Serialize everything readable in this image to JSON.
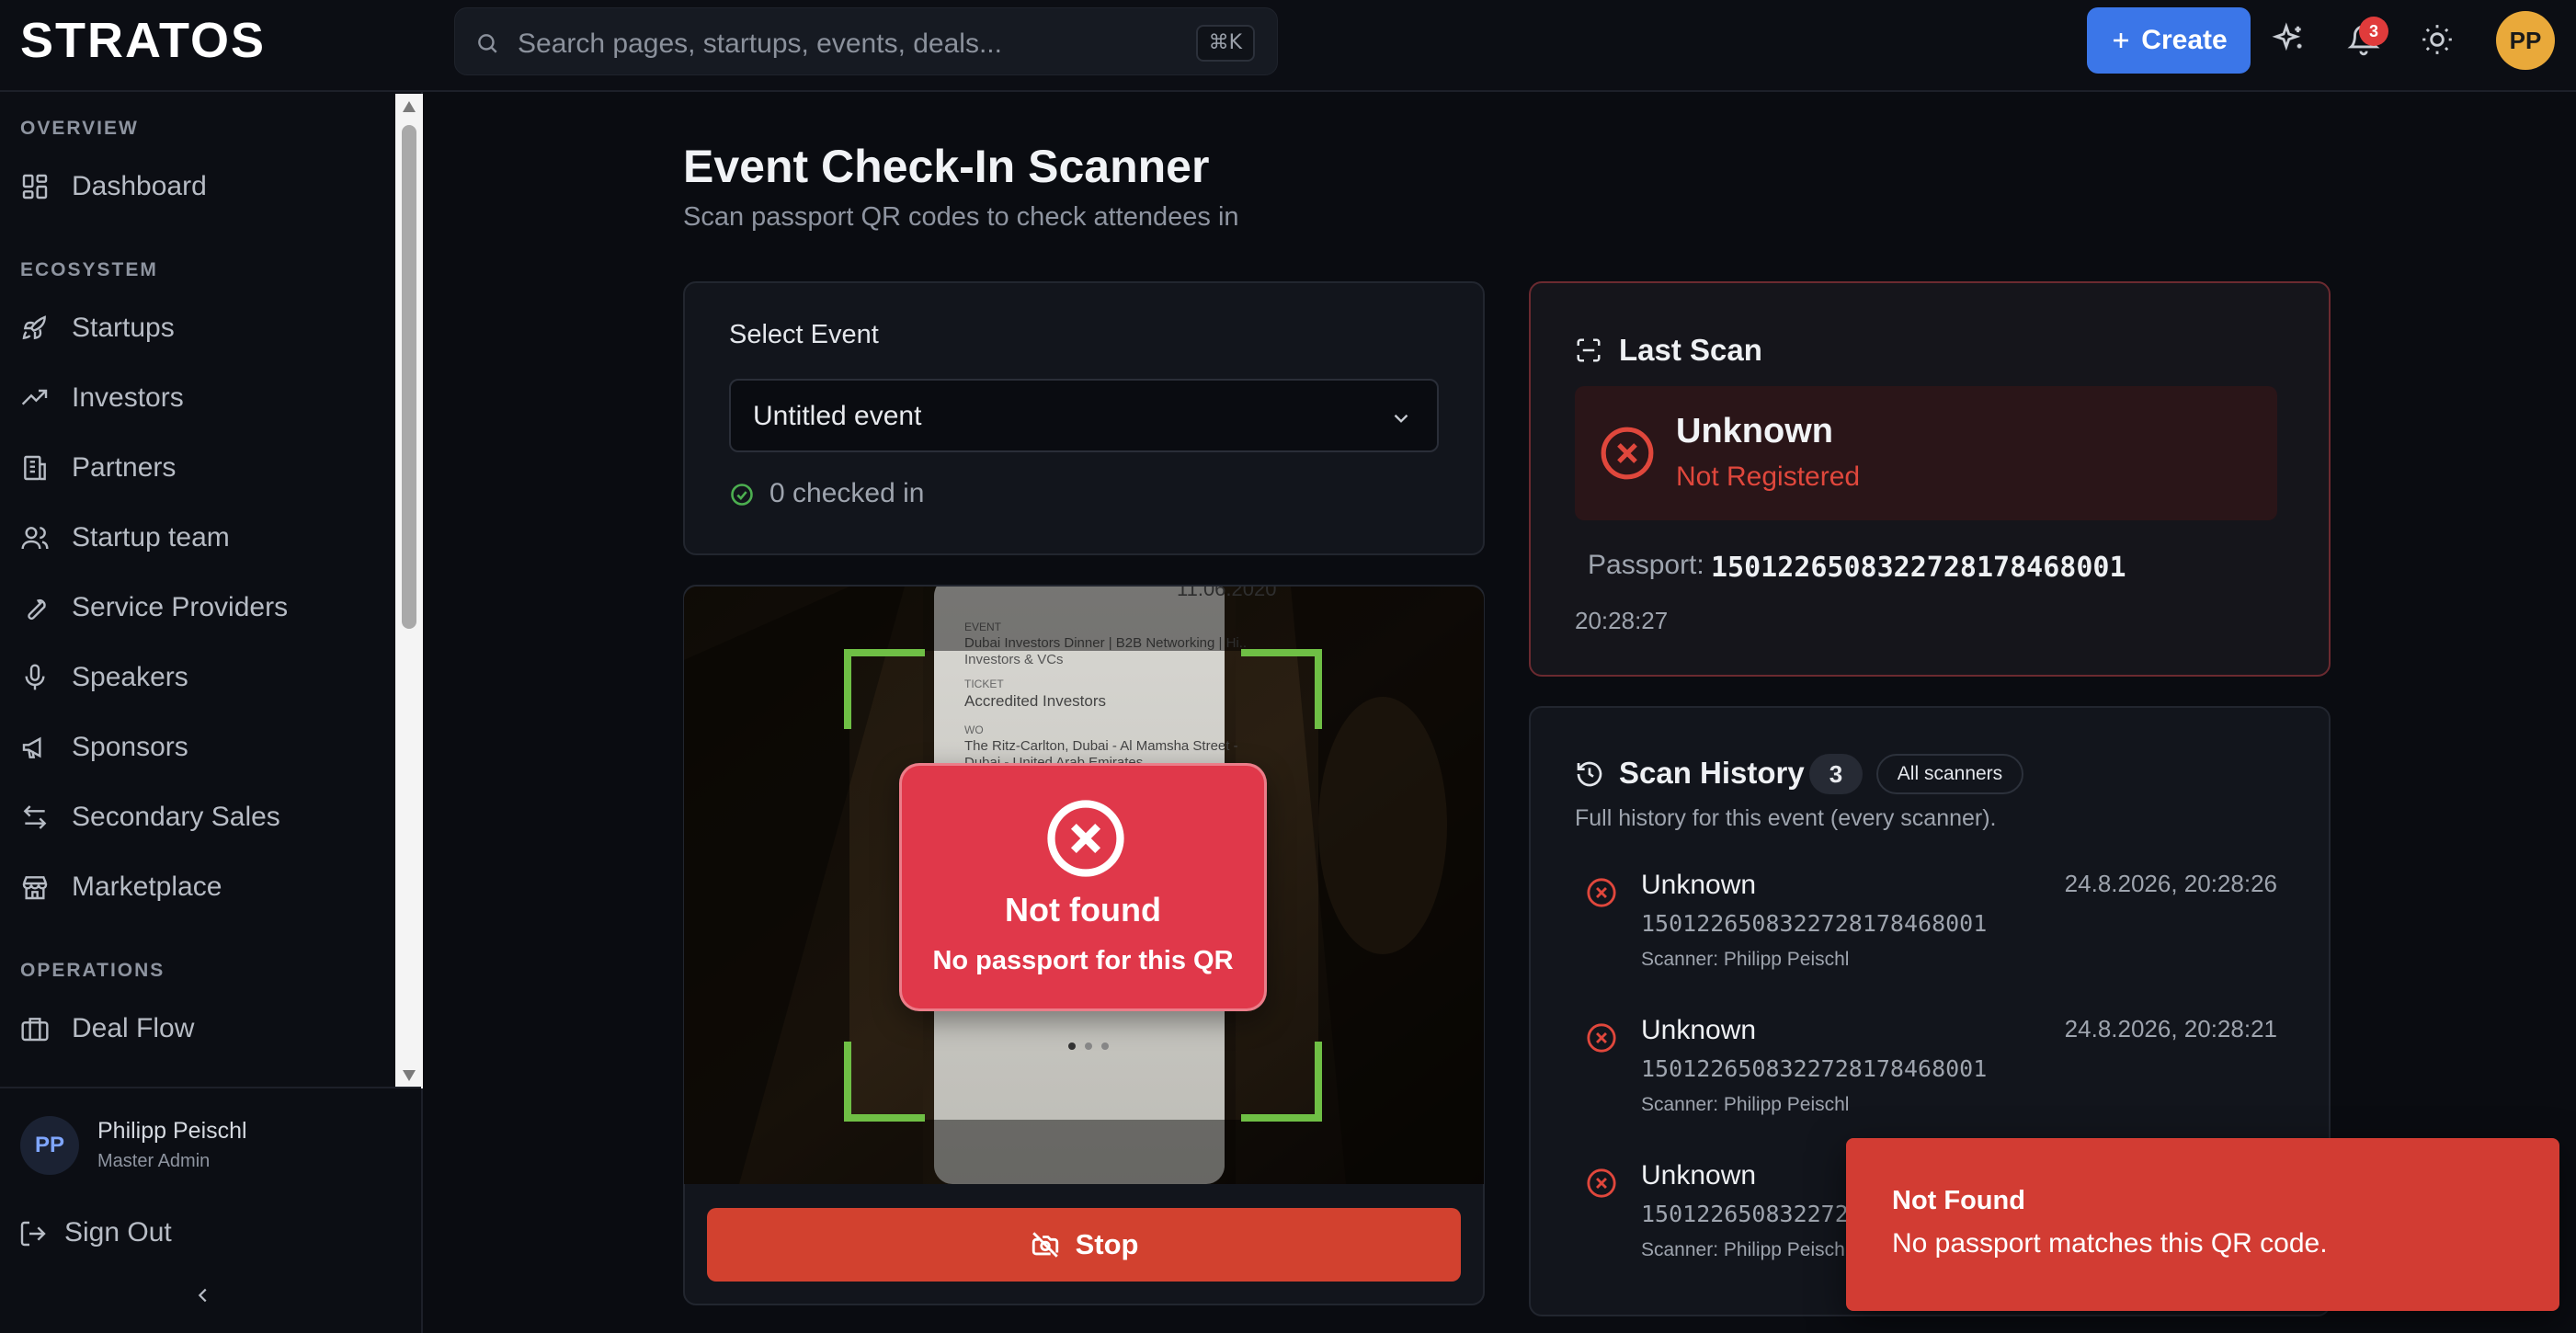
{
  "app": {
    "logo": "STRATOS"
  },
  "search": {
    "placeholder": "Search pages, startups, events, deals...",
    "shortcut": "⌘K"
  },
  "header": {
    "create_label": "Create",
    "notification_count": "3",
    "avatar_initials": "PP"
  },
  "sidebar": {
    "sections": [
      {
        "title": "OVERVIEW",
        "items": [
          {
            "label": "Dashboard",
            "icon": "grid-icon"
          }
        ]
      },
      {
        "title": "ECOSYSTEM",
        "items": [
          {
            "label": "Startups",
            "icon": "rocket-icon"
          },
          {
            "label": "Investors",
            "icon": "trending-up-icon"
          },
          {
            "label": "Partners",
            "icon": "building-icon"
          },
          {
            "label": "Startup team",
            "icon": "users-icon"
          },
          {
            "label": "Service Providers",
            "icon": "wrench-icon"
          },
          {
            "label": "Speakers",
            "icon": "mic-icon"
          },
          {
            "label": "Sponsors",
            "icon": "megaphone-icon"
          },
          {
            "label": "Secondary Sales",
            "icon": "arrows-icon"
          },
          {
            "label": "Marketplace",
            "icon": "store-icon"
          }
        ]
      },
      {
        "title": "OPERATIONS",
        "items": [
          {
            "label": "Deal Flow",
            "icon": "briefcase-icon"
          }
        ]
      }
    ],
    "user": {
      "initials": "PP",
      "name": "Philipp Peischl",
      "role": "Master Admin"
    },
    "sign_out": "Sign Out"
  },
  "page": {
    "title": "Event Check-In Scanner",
    "subtitle": "Scan passport QR codes to check attendees in"
  },
  "event_select": {
    "label": "Select Event",
    "value": "Untitled event",
    "checked_in": "0 checked in"
  },
  "scanner": {
    "overlay_title": "Not found",
    "overlay_message": "No passport for this QR",
    "stop_label": "Stop"
  },
  "last_scan": {
    "title": "Last Scan",
    "name": "Unknown",
    "status": "Not Registered",
    "passport_label": "Passport:",
    "passport_id": "150122650832272817846800",
    "passport_id_full": "15012265083227281784680 01",
    "time": "20:28:27"
  },
  "history": {
    "title": "Scan History",
    "count": "3",
    "scope": "All scanners",
    "description": "Full history for this event (every scanner).",
    "rows": [
      {
        "name": "Unknown",
        "passport": "150122650832272817846800 1",
        "scanner": "Scanner: Philipp Peischl",
        "timestamp": "24.8.2026, 20:28:26"
      },
      {
        "name": "Unknown",
        "passport": "150122650832272817846800 1",
        "scanner": "Scanner: Philipp Peischl",
        "timestamp": "24.8.2026, 20:28:21"
      },
      {
        "name": "Unknown",
        "passport": "1501226508322728",
        "scanner": "Scanner: Philipp Peisch",
        "timestamp": ""
      }
    ]
  },
  "toast": {
    "title": "Not Found",
    "message": "No passport matches this QR code."
  },
  "colors": {
    "accent": "#3b76e8",
    "error": "#e0473c",
    "success": "#4caf50",
    "scan_frame": "#6fbf45"
  }
}
